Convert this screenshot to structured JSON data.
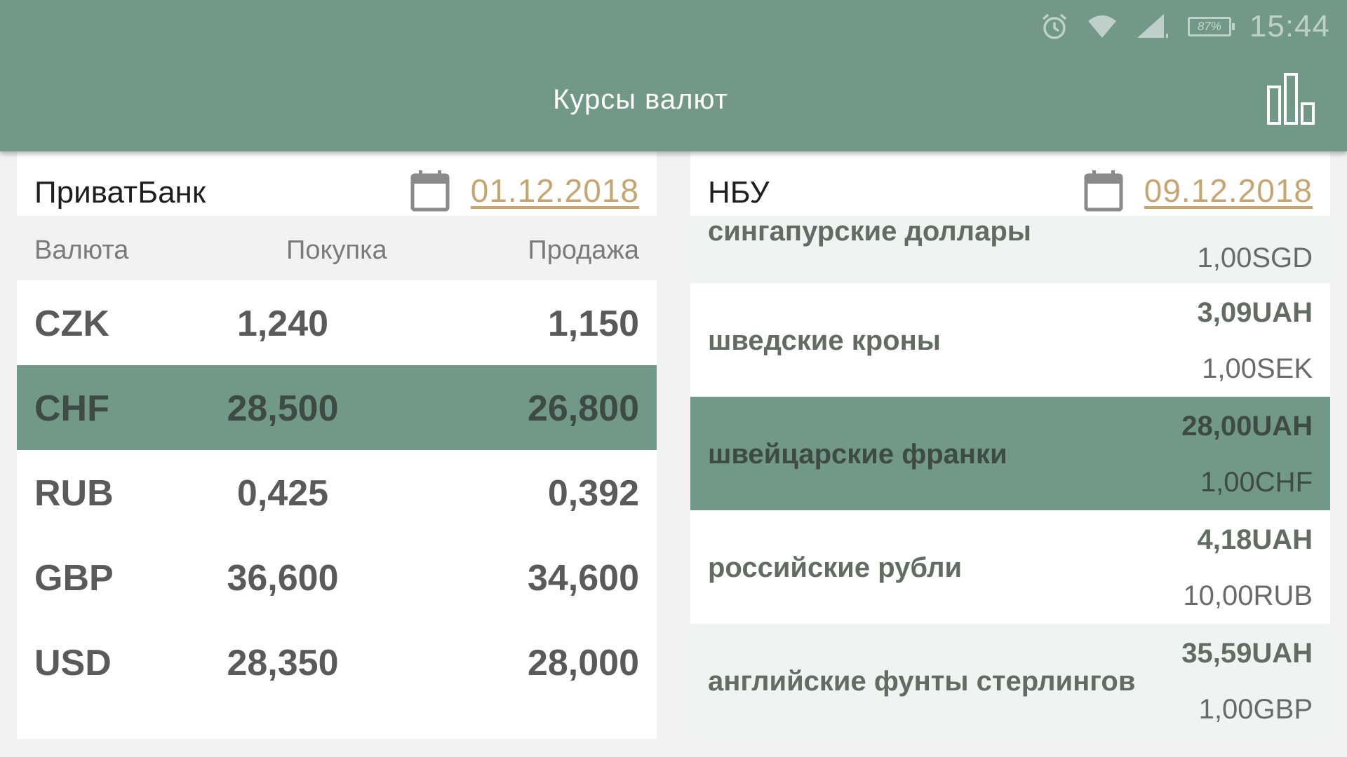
{
  "status_bar": {
    "battery": "87%",
    "time": "15:44",
    "icons": [
      "alarm-icon",
      "wifi-icon",
      "signal-icon",
      "battery-icon"
    ]
  },
  "app_bar": {
    "title": "Курсы валют",
    "action_icon": "bar-chart-icon"
  },
  "privatbank": {
    "name": "ПриватБанк",
    "date": "01.12.2018",
    "columns": {
      "currency": "Валюта",
      "buy": "Покупка",
      "sell": "Продажа"
    },
    "rows": [
      {
        "code": "CZK",
        "buy": "1,240",
        "sell": "1,150"
      },
      {
        "code": "CHF",
        "buy": "28,500",
        "sell": "26,800"
      },
      {
        "code": "RUB",
        "buy": "0,425",
        "sell": "0,392"
      },
      {
        "code": "GBP",
        "buy": "36,600",
        "sell": "34,600"
      },
      {
        "code": "USD",
        "buy": "28,350",
        "sell": "28,000"
      }
    ],
    "selected_code": "CHF"
  },
  "nbu": {
    "name": "НБУ",
    "date": "09.12.2018",
    "first_partial": {
      "name": "сингапурские доллары",
      "unit": "1,00SGD"
    },
    "rows": [
      {
        "name": "шведские кроны",
        "uah": "3,09UAH",
        "unit": "1,00SEK"
      },
      {
        "name": "швейцарские франки",
        "uah": "28,00UAH",
        "unit": "1,00CHF"
      },
      {
        "name": "российские рубли",
        "uah": "4,18UAH",
        "unit": "10,00RUB"
      },
      {
        "name": "английские фунты стерлингов",
        "uah": "35,59UAH",
        "unit": "1,00GBP"
      }
    ],
    "selected_name": "швейцарские франки"
  },
  "colors": {
    "primary": "#72988a",
    "date_link": "#c6a670",
    "row_alt": "#eff3f1"
  }
}
